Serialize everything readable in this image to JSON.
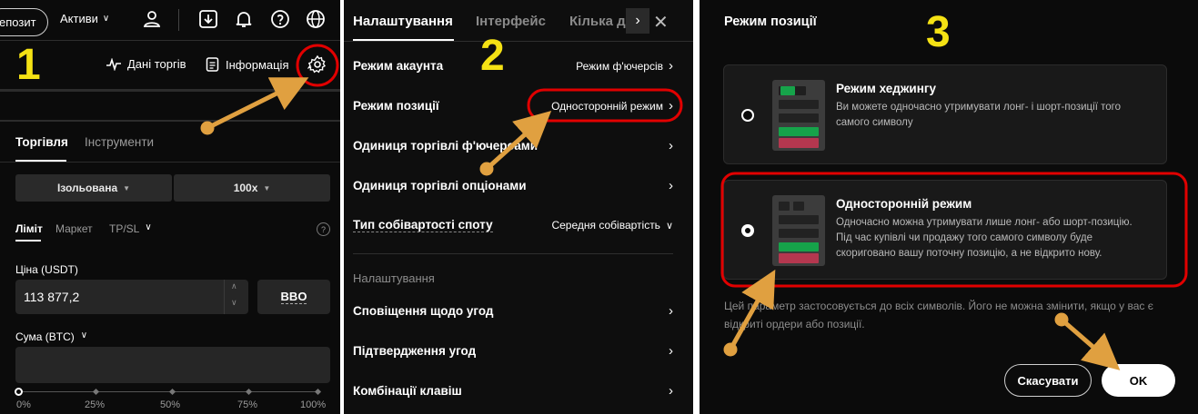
{
  "steps": {
    "one": "1",
    "two": "2",
    "three": "3"
  },
  "panel1": {
    "header": {
      "deposit": "епозит",
      "assets": "Активи"
    },
    "sub": {
      "trade_data": "Дані торгів",
      "info": "Інформація"
    },
    "tabs": [
      "Торгівля",
      "Інструменти"
    ],
    "margin_mode": "Ізольована",
    "leverage": "100x",
    "order_types": [
      "Ліміт",
      "Маркет",
      "TP/SL"
    ],
    "price_label": "Ціна (USDT)",
    "price_value": "113 877,2",
    "bbo": "BBO",
    "amount_label": "Сума (BTC)",
    "slider_ticks": [
      "0%",
      "25%",
      "50%",
      "75%",
      "100%"
    ]
  },
  "panel2": {
    "tabs": [
      "Налаштування",
      "Інтерфейс",
      "Кілька д"
    ],
    "rows": [
      {
        "label": "Режим акаунта",
        "value": "Режим ф'ючерсів"
      },
      {
        "label": "Режим позиції",
        "value": "Односторонній режим"
      },
      {
        "label": "Одиниця торгівлі ф'ючерсами",
        "value": ""
      },
      {
        "label": "Одиниця торгівлі опціонами",
        "value": ""
      },
      {
        "label": "Тип собівартості споту",
        "value": "Середня собівартість"
      }
    ],
    "section": "Налаштування",
    "rows2": [
      {
        "label": "Сповіщення щодо угод"
      },
      {
        "label": "Підтвердження угод"
      },
      {
        "label": "Комбінації клавіш"
      }
    ]
  },
  "panel3": {
    "title": "Режим позиції",
    "hedge": {
      "title": "Режим хеджингу",
      "desc": "Ви можете одночасно утримувати лонг- і шорт-позиції того самого символу"
    },
    "oneway": {
      "title": "Односторонній режим",
      "desc": "Одночасно можна утримувати лише лонг- або шорт-позицію. Під час купівлі чи продажу того самого символу буде скориговано вашу поточну позицію, а не відкрито нову."
    },
    "note": "Цей параметр застосовується до всіх символів. Його не можна змінити, якщо у вас є відкриті ордери або позиції.",
    "cancel": "Скасувати",
    "ok": "OK"
  },
  "colors": {
    "annotation_yellow": "#f5e214",
    "highlight_red": "#e10000",
    "arrow": "#e0a040",
    "green": "#16a34a",
    "red": "#b4374f"
  }
}
